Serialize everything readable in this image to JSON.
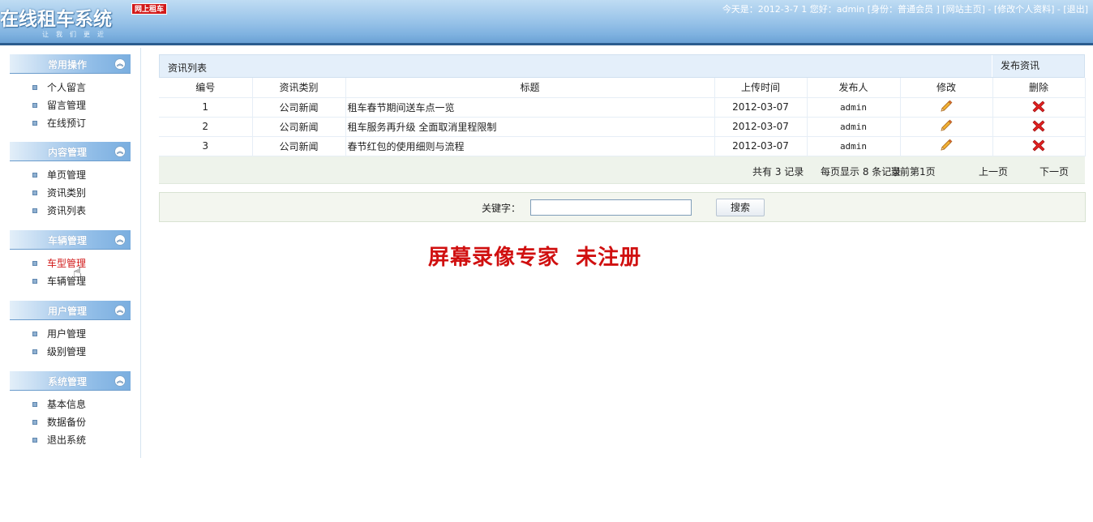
{
  "header": {
    "logo_title": "在线租车系统",
    "logo_badge": "网上租车",
    "logo_sub": "让我们更近",
    "today_label": "今天是：2012-3-7 1 ",
    "greeting": "您好：admin [身份：普通会员 ] ",
    "link_home": "[网站主页]",
    "sep1": " - ",
    "link_profile": "[修改个人资料]",
    "sep2": " - ",
    "link_logout": "[退出]"
  },
  "sidebar": {
    "groups": [
      {
        "title": "常用操作",
        "items": [
          "个人留言",
          "留言管理",
          "在线预订"
        ]
      },
      {
        "title": "内容管理",
        "items": [
          "单页管理",
          "资讯类别",
          "资讯列表"
        ]
      },
      {
        "title": "车辆管理",
        "items": [
          "车型管理",
          "车辆管理"
        ]
      },
      {
        "title": "用户管理",
        "items": [
          "用户管理",
          "级别管理"
        ]
      },
      {
        "title": "系统管理",
        "items": [
          "基本信息",
          "数据备份",
          "退出系统"
        ]
      }
    ],
    "collapse_glyph": "︽"
  },
  "list": {
    "title": "资讯列表",
    "publish": "发布资讯",
    "columns": [
      "编号",
      "资讯类别",
      "标题",
      "上传时间",
      "发布人",
      "修改",
      "删除"
    ],
    "rows": [
      [
        "1",
        "公司新闻",
        "租车春节期间送车点一览",
        "2012-03-07",
        "admin"
      ],
      [
        "2",
        "公司新闻",
        "租车服务再升级 全面取消里程限制",
        "2012-03-07",
        "admin"
      ],
      [
        "3",
        "公司新闻",
        "春节红包的使用细则与流程",
        "2012-03-07",
        "admin"
      ]
    ]
  },
  "pager": {
    "total": "共有 3 记录",
    "per_page": "每页显示 8 条记录",
    "current": "当前第1页",
    "prev": "上一页",
    "next": "下一页"
  },
  "search": {
    "label": "关键字：",
    "value": "",
    "button": "搜索"
  },
  "watermark": "屏幕录像专家  未注册",
  "colors": {
    "header_blue": "#7fb2e0",
    "active_menu": "#d11919",
    "watermark": "#d01010",
    "delete_red": "#e02020",
    "edit_orange": "#f0a020"
  }
}
